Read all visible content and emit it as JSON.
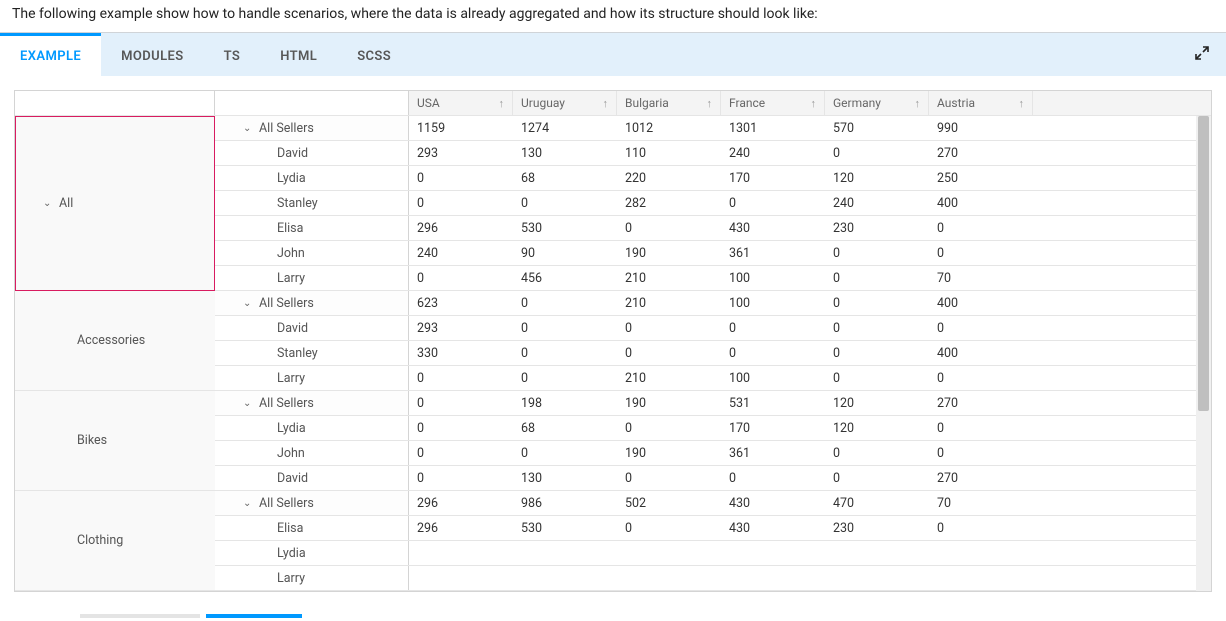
{
  "intro": "The following example show how to handle scenarios, where the data is already aggregated and how its structure should look like:",
  "tabs": {
    "example": "EXAMPLE",
    "modules": "MODULES",
    "ts": "TS",
    "html": "HTML",
    "scss": "SCSS"
  },
  "columns": [
    "USA",
    "Uruguay",
    "Bulgaria",
    "France",
    "Germany",
    "Austria"
  ],
  "allLabel": "All",
  "allSellersLabel": "All Sellers",
  "groups": [
    {
      "category": "",
      "rows": [
        {
          "seller": "All Sellers",
          "type": "all",
          "values": [
            "1159",
            "1274",
            "1012",
            "1301",
            "570",
            "990"
          ]
        },
        {
          "seller": "David",
          "type": "child",
          "values": [
            "293",
            "130",
            "110",
            "240",
            "0",
            "270"
          ]
        },
        {
          "seller": "Lydia",
          "type": "child",
          "values": [
            "0",
            "68",
            "220",
            "170",
            "120",
            "250"
          ]
        },
        {
          "seller": "Stanley",
          "type": "child",
          "values": [
            "0",
            "0",
            "282",
            "0",
            "240",
            "400"
          ]
        },
        {
          "seller": "Elisa",
          "type": "child",
          "values": [
            "296",
            "530",
            "0",
            "430",
            "230",
            "0"
          ]
        },
        {
          "seller": "John",
          "type": "child",
          "values": [
            "240",
            "90",
            "190",
            "361",
            "0",
            "0"
          ]
        },
        {
          "seller": "Larry",
          "type": "child",
          "values": [
            "0",
            "456",
            "210",
            "100",
            "0",
            "70"
          ]
        }
      ]
    },
    {
      "category": "Accessories",
      "rows": [
        {
          "seller": "All Sellers",
          "type": "all",
          "values": [
            "623",
            "0",
            "210",
            "100",
            "0",
            "400"
          ]
        },
        {
          "seller": "David",
          "type": "child",
          "values": [
            "293",
            "0",
            "0",
            "0",
            "0",
            "0"
          ]
        },
        {
          "seller": "Stanley",
          "type": "child",
          "values": [
            "330",
            "0",
            "0",
            "0",
            "0",
            "400"
          ]
        },
        {
          "seller": "Larry",
          "type": "child",
          "values": [
            "0",
            "0",
            "210",
            "100",
            "0",
            "0"
          ]
        }
      ]
    },
    {
      "category": "Bikes",
      "rows": [
        {
          "seller": "All Sellers",
          "type": "all",
          "values": [
            "0",
            "198",
            "190",
            "531",
            "120",
            "270"
          ]
        },
        {
          "seller": "Lydia",
          "type": "child",
          "values": [
            "0",
            "68",
            "0",
            "170",
            "120",
            "0"
          ]
        },
        {
          "seller": "John",
          "type": "child",
          "values": [
            "0",
            "0",
            "190",
            "361",
            "0",
            "0"
          ]
        },
        {
          "seller": "David",
          "type": "child",
          "values": [
            "0",
            "130",
            "0",
            "0",
            "0",
            "270"
          ]
        }
      ]
    },
    {
      "category": "Clothing",
      "rows": [
        {
          "seller": "All Sellers",
          "type": "all",
          "values": [
            "296",
            "986",
            "502",
            "430",
            "470",
            "70"
          ]
        },
        {
          "seller": "Elisa",
          "type": "child",
          "values": [
            "296",
            "530",
            "0",
            "430",
            "230",
            "0"
          ]
        },
        {
          "seller": "Lydia",
          "type": "child",
          "values": [
            "",
            "",
            "",
            "",
            "",
            ""
          ]
        },
        {
          "seller": "Larry",
          "type": "child",
          "values": [
            "",
            "",
            "",
            "",
            "",
            ""
          ]
        }
      ]
    }
  ]
}
